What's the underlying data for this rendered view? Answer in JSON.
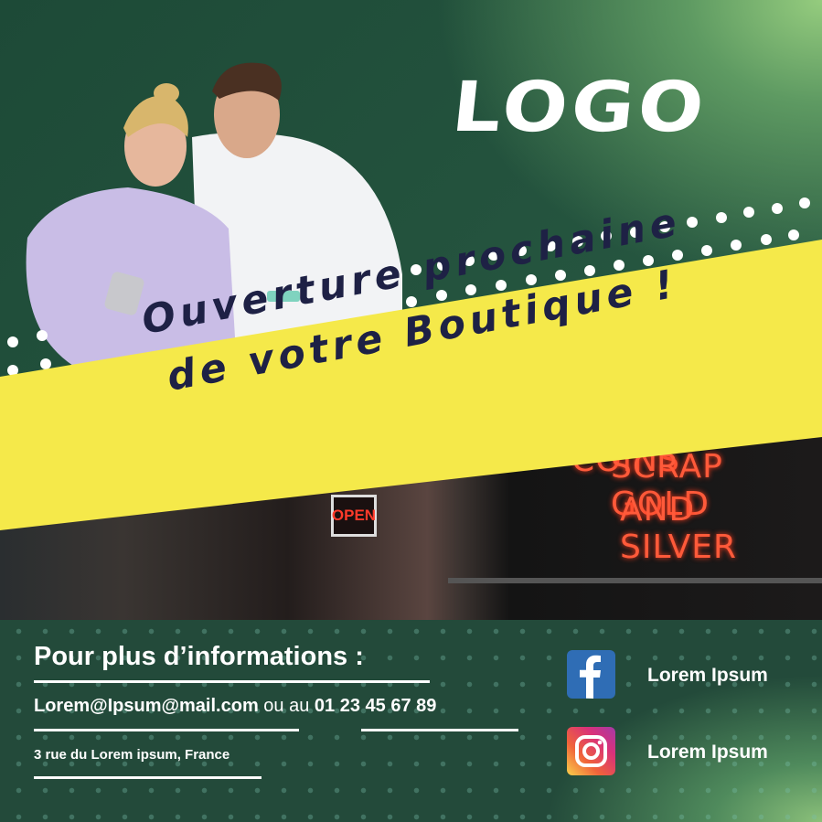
{
  "logo": {
    "text": "LOGO"
  },
  "banner": {
    "line1": "Ouverture prochaine",
    "line2": "de votre Boutique !",
    "background_color": "#f5e94a",
    "text_color": "#1e2145"
  },
  "store_photo": {
    "neon_lines": [
      "BUYERS OF COINS",
      "SCRAP GOLD",
      "AND SILVER"
    ],
    "open_sign": "OPEN"
  },
  "footer": {
    "heading": "Pour plus d’informations :",
    "email": "Lorem@Ipsum@mail.com",
    "connector": "ou au",
    "phone": "01 23 45 67 89",
    "address": "3 rue du Lorem ipsum, France",
    "social": [
      {
        "icon": "facebook-icon",
        "label": "Lorem Ipsum",
        "color": "#2f6db5"
      },
      {
        "icon": "instagram-icon",
        "label": "Lorem Ipsum",
        "color": "#e1306c"
      }
    ]
  }
}
